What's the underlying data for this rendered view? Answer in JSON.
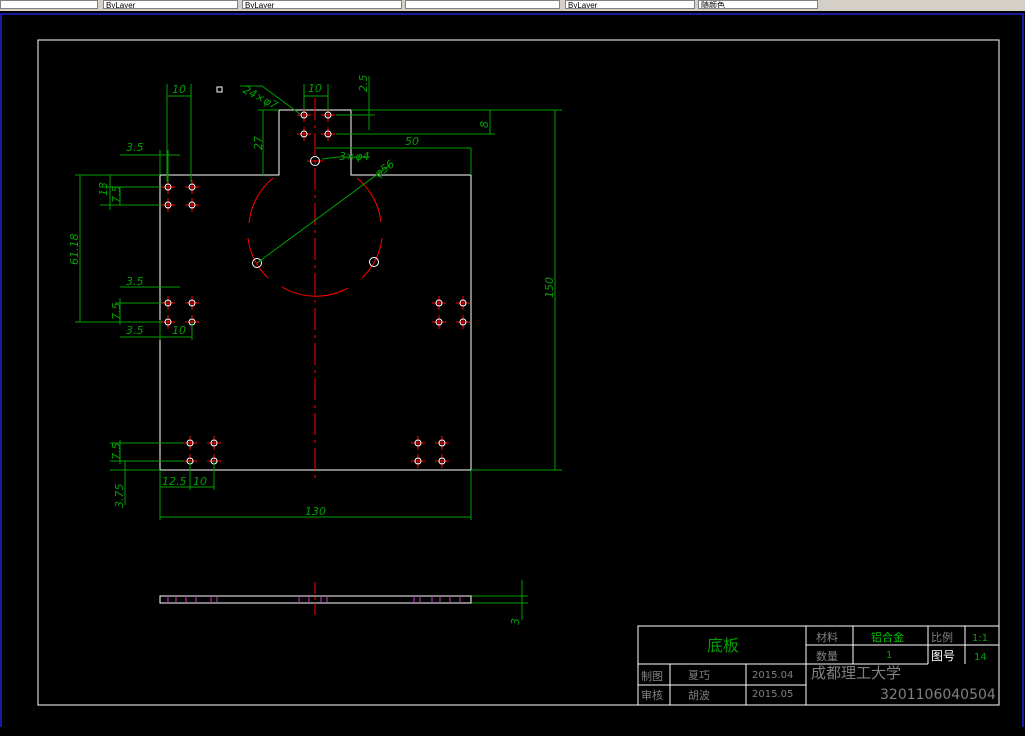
{
  "toolbar": {
    "field1": "ByLayer",
    "field2": "ByLayer",
    "field3": "ByLayer",
    "field4": "随颜色"
  },
  "dims": {
    "d10_top_left": "10",
    "d10_top": "10",
    "d25": "2.5",
    "holes24": "24×φ7",
    "d8": "8",
    "d50": "50",
    "d27": "27",
    "holes3": "3×φ4",
    "d56": "φ56",
    "d35_a": "3.5",
    "d13": "13",
    "d75_a": "7.5",
    "d6118": "61.18",
    "d35_b": "3.5",
    "d75_b": "7.5",
    "d35_c": "3.5",
    "d10_b": "10",
    "d150": "150",
    "d75_c": "7.5",
    "d375": "3.75",
    "d125": "12.5",
    "d10_c": "10",
    "d130": "130",
    "d3": "3"
  },
  "title_block": {
    "part_name": "底板",
    "material_label": "材料",
    "material_value": "铝合金",
    "scale_label": "比例",
    "scale_value": "1:1",
    "qty_label": "数量",
    "qty_value": "1",
    "drawing_no_label": "图号",
    "drawing_no_value": "14",
    "drawn_label": "制图",
    "drawn_name": "夏巧",
    "drawn_date": "2015.04",
    "check_label": "审核",
    "check_name": "胡波",
    "check_date": "2015.05",
    "school": "成都理工大学",
    "student_id": "3201106040504"
  },
  "colors": {
    "background": "#000000",
    "outline": "#ffffff",
    "dimension": "#00a000",
    "centerline": "#ff0000",
    "border_blue": "#1a1aa0",
    "marker": "#c040c0"
  }
}
